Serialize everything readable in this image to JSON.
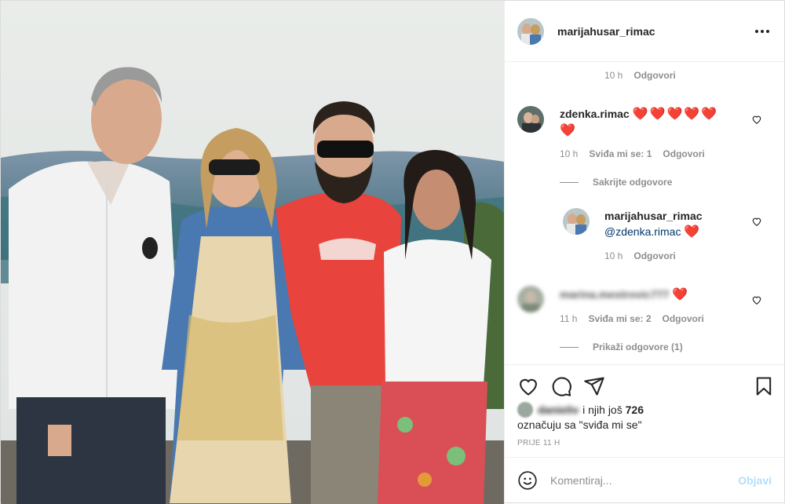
{
  "post": {
    "author": "marijahusar_rimac",
    "photo_description_icon": "group-photo"
  },
  "header": {
    "username": "marijahusar_rimac",
    "more_icon": "more-horizontal-icon"
  },
  "comments": {
    "top_meta": {
      "time": "10 h",
      "reply": "Odgovori"
    },
    "c1": {
      "user": "zdenka.rimac",
      "hearts": "❤️❤️❤️❤️❤️",
      "hearts2": "❤️",
      "time": "10 h",
      "likes": "Sviđa mi se: 1",
      "reply": "Odgovori"
    },
    "hide_replies": "Sakrijte odgovore",
    "reply1": {
      "user": "marijahusar_rimac",
      "mention": "@zdenka.rimac",
      "hearts": "❤️",
      "time": "10 h",
      "reply": "Odgovori"
    },
    "c2": {
      "user": "marina.mestrovic777",
      "hearts": "❤️",
      "time": "11 h",
      "likes": "Sviđa mi se: 2",
      "reply": "Odgovori"
    },
    "show_replies": "Prikaži odgovore (1)"
  },
  "actions": {
    "liked_by_user": "danieliv",
    "liked_by_rest": "i njih još",
    "liked_count": "726",
    "liked_suffix": "označuju sa \"sviđa mi se\"",
    "time_ago": "PRIJE 11 H"
  },
  "comment_box": {
    "placeholder": "Komentiraj...",
    "post_label": "Objavi"
  },
  "colors": {
    "accent": "#0095f6",
    "post_disabled": "#b2dffc",
    "heart": "#ed4956",
    "mention": "#00376b",
    "muted": "#8e8e8e"
  }
}
